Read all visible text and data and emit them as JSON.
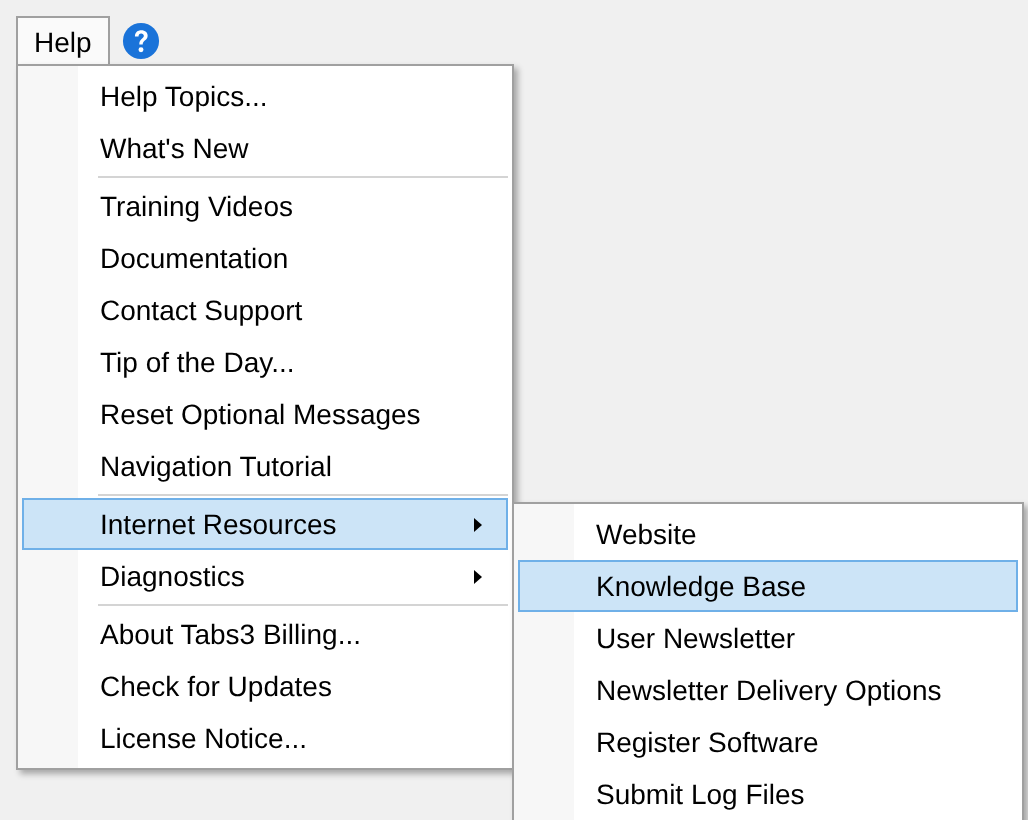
{
  "menu_bar": [
    {
      "label": "Help",
      "selected": true
    }
  ],
  "menu": {
    "items": [
      {
        "kind": "item",
        "label": "Help Topics...",
        "has_submenu": false,
        "selected": false
      },
      {
        "kind": "item",
        "label": "What's New",
        "has_submenu": false,
        "selected": false
      },
      {
        "kind": "separator"
      },
      {
        "kind": "item",
        "label": "Training Videos",
        "has_submenu": false,
        "selected": false
      },
      {
        "kind": "item",
        "label": "Documentation",
        "has_submenu": false,
        "selected": false
      },
      {
        "kind": "item",
        "label": "Contact Support",
        "has_submenu": false,
        "selected": false
      },
      {
        "kind": "item",
        "label": "Tip of the Day...",
        "has_submenu": false,
        "selected": false
      },
      {
        "kind": "item",
        "label": "Reset Optional Messages",
        "has_submenu": false,
        "selected": false
      },
      {
        "kind": "item",
        "label": "Navigation Tutorial",
        "has_submenu": false,
        "selected": false
      },
      {
        "kind": "separator"
      },
      {
        "kind": "item",
        "label": "Internet Resources",
        "has_submenu": true,
        "selected": true
      },
      {
        "kind": "item",
        "label": "Diagnostics",
        "has_submenu": true,
        "selected": false
      },
      {
        "kind": "separator"
      },
      {
        "kind": "item",
        "label": "About Tabs3 Billing...",
        "has_submenu": false,
        "selected": false
      },
      {
        "kind": "item",
        "label": "Check for Updates",
        "has_submenu": false,
        "selected": false
      },
      {
        "kind": "item",
        "label": "License Notice...",
        "has_submenu": false,
        "selected": false
      }
    ]
  },
  "submenu": {
    "items": [
      {
        "kind": "item",
        "label": "Website",
        "has_submenu": false,
        "selected": false
      },
      {
        "kind": "item",
        "label": "Knowledge Base",
        "has_submenu": false,
        "selected": true
      },
      {
        "kind": "item",
        "label": "User Newsletter",
        "has_submenu": false,
        "selected": false
      },
      {
        "kind": "item",
        "label": "Newsletter Delivery Options",
        "has_submenu": false,
        "selected": false
      },
      {
        "kind": "item",
        "label": "Register Software",
        "has_submenu": false,
        "selected": false
      },
      {
        "kind": "item",
        "label": "Submit Log Files",
        "has_submenu": false,
        "selected": false
      }
    ]
  }
}
